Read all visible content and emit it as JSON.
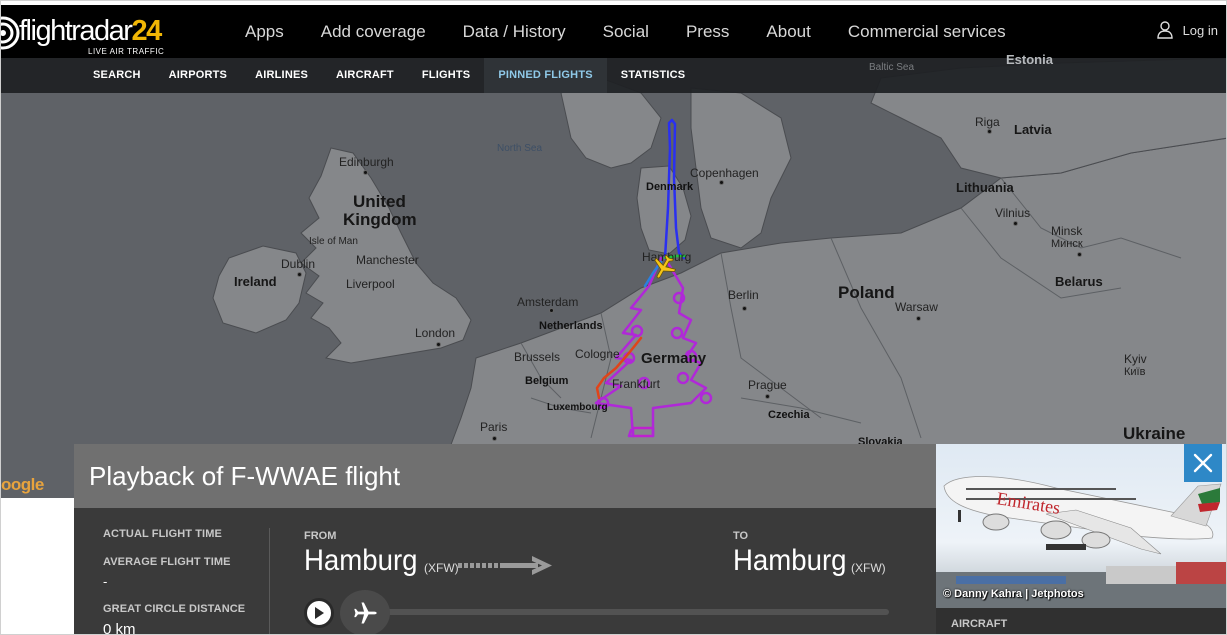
{
  "brand": {
    "logo_text": "flightradar",
    "logo_number": "24",
    "tagline": "LIVE AIR TRAFFIC"
  },
  "top_nav": [
    "Apps",
    "Add coverage",
    "Data / History",
    "Social",
    "Press",
    "About",
    "Commercial services"
  ],
  "login_label": "Log in",
  "sub_nav": [
    "SEARCH",
    "AIRPORTS",
    "AIRLINES",
    "AIRCRAFT",
    "FLIGHTS",
    "PINNED FLIGHTS",
    "STATISTICS"
  ],
  "sub_nav_active": "PINNED FLIGHTS",
  "map": {
    "labels": {
      "baltic_sea": "Baltic Sea",
      "estonia": "Estonia",
      "north_sea": "North Sea",
      "riga": "Riga",
      "latvia": "Latvia",
      "edinburgh": "Edinburgh",
      "denmark": "Denmark",
      "copenhagen": "Copenhagen",
      "lithuania": "Lithuania",
      "united": "United",
      "kingdom": "Kingdom",
      "vilnius": "Vilnius",
      "isle_of_man": "Isle of Man",
      "minsk": "Minsk",
      "minsk_cyr": "Минск",
      "dublin": "Dublin",
      "manchester": "Manchester",
      "hamburg": "Hamburg",
      "ireland": "Ireland",
      "liverpool": "Liverpool",
      "belarus": "Belarus",
      "berlin": "Berlin",
      "amsterdam": "Amsterdam",
      "poland": "Poland",
      "warsaw": "Warsaw",
      "netherlands": "Netherlands",
      "london": "London",
      "germany": "Germany",
      "brussels": "Brussels",
      "cologne": "Cologne",
      "kyiv": "Kyiv",
      "kyiv_cyr": "Київ",
      "belgium": "Belgium",
      "frankfurt": "Frankfurt",
      "prague": "Prague",
      "luxembourg": "Luxembourg",
      "czechia": "Czechia",
      "paris": "Paris",
      "slovakia": "Slovakia",
      "ukraine": "Ukraine"
    },
    "google_mark": "oogle",
    "track_colors": [
      "#2030ff",
      "#5a2bd6",
      "#9a22e0",
      "#c21fd8",
      "#e04a10",
      "#d01020",
      "#20c040",
      "#2a7fe0"
    ]
  },
  "playback": {
    "title": "Playback of F-WWAE flight",
    "stats": [
      {
        "label": "ACTUAL FLIGHT TIME",
        "value": ""
      },
      {
        "label": "AVERAGE FLIGHT TIME",
        "value": "-"
      },
      {
        "label": "GREAT CIRCLE DISTANCE",
        "value": "0 km"
      }
    ],
    "from_label": "FROM",
    "from_city": "Hamburg",
    "from_iata": "(XFW)",
    "to_label": "TO",
    "to_city": "Hamburg",
    "to_iata": "(XFW)",
    "progress": 0
  },
  "aircraft_card": {
    "photo_credit": "© Danny Kahra | Jetphotos",
    "section_label": "AIRCRAFT",
    "livery_text": "Emirates"
  },
  "icons": {
    "user": "user-icon",
    "close": "close-icon",
    "play": "play-icon",
    "plane": "airplane-icon",
    "arrow": "route-arrow-icon"
  }
}
